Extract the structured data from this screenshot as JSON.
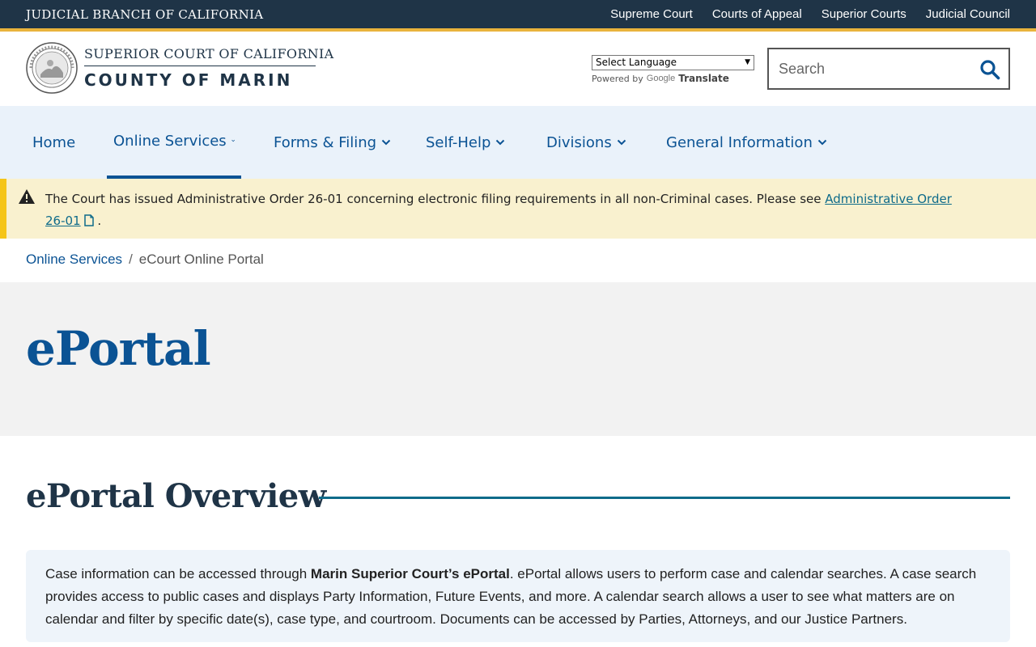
{
  "topbar": {
    "branch_title": "JUDICIAL BRANCH OF CALIFORNIA",
    "links": [
      "Supreme Court",
      "Courts of Appeal",
      "Superior Courts",
      "Judicial Council"
    ]
  },
  "header": {
    "court_line1": "SUPERIOR COURT OF CALIFORNIA",
    "court_line2": "COUNTY OF MARIN",
    "language_select": "Select Language",
    "powered_by": "Powered by",
    "google": "Google",
    "translate": "Translate",
    "search_placeholder": "Search"
  },
  "nav": {
    "items": [
      {
        "label": "Home"
      },
      {
        "label": "Online Services"
      },
      {
        "label": "Forms & Filing"
      },
      {
        "label": "Self-Help"
      },
      {
        "label": "Divisions"
      },
      {
        "label": "General Information"
      }
    ]
  },
  "alert": {
    "text": "The Court has issued Administrative Order 26-01 concerning electronic filing requirements in all non-Criminal cases. Please see ",
    "link": "Administrative Order 26-01",
    "suffix": " ."
  },
  "breadcrumb": {
    "parent": "Online Services",
    "separator": "/",
    "current": "eCourt Online Portal"
  },
  "hero": {
    "title": "ePortal"
  },
  "section": {
    "title": "ePortal Overview",
    "body_pre": "Case information can be accessed through ",
    "body_bold": "Marin Superior Court’s ePortal",
    "body_post": ". ePortal allows users to perform case and calendar searches. A case search provides access to public cases and displays Party Information, Future Events, and more. A calendar search allows a user to see what matters are on calendar and filter by specific date(s), case type, and courtroom. Documents can be accessed by Parties, Attorneys, and our Justice Partners."
  },
  "colors": {
    "navy": "#1f3447",
    "accent_gold": "#e9b33c",
    "link_blue": "#0b5394",
    "teal": "#0e6b8a",
    "alert_bg": "#f9f1cf"
  }
}
